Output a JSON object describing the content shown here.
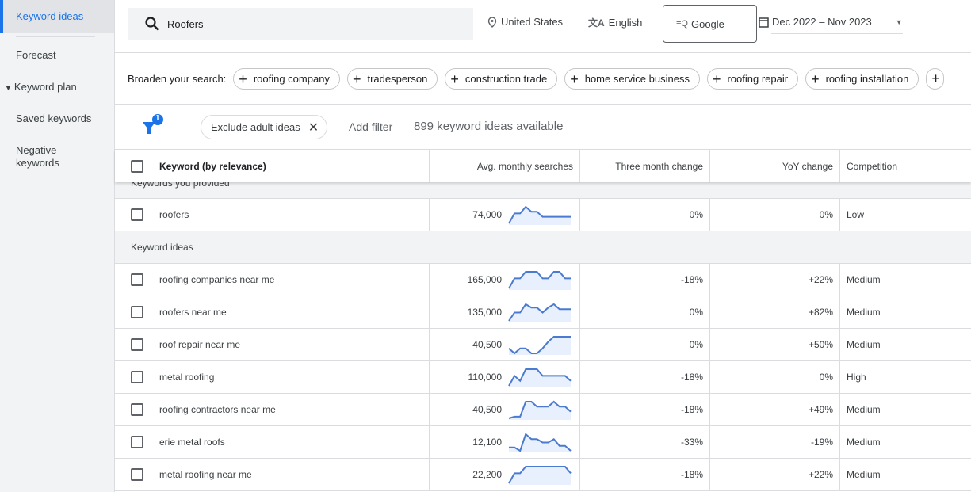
{
  "sidebar": {
    "items": [
      {
        "label": "Keyword ideas",
        "active": true
      },
      {
        "label": "Forecast"
      },
      {
        "label": "Keyword plan"
      },
      {
        "label": "Saved keywords"
      },
      {
        "label": "Negative keywords"
      }
    ]
  },
  "search": {
    "value": "Roofers",
    "icon": "search-icon"
  },
  "location": "United States",
  "language": "English",
  "network": "Google",
  "date_range": "Dec 2022 – Nov 2023",
  "broaden": {
    "label": "Broaden your search:",
    "chips": [
      "roofing company",
      "tradesperson",
      "construction trade",
      "home service business",
      "roofing repair",
      "roofing installation"
    ]
  },
  "filters": {
    "badge": "1",
    "chip": "Exclude adult ideas",
    "add_filter": "Add filter",
    "count": "899 keyword ideas available"
  },
  "accent": "#1a73e8",
  "table": {
    "columns": [
      "Keyword (by relevance)",
      "Avg. monthly searches",
      "Three month change",
      "YoY change",
      "Competition"
    ],
    "sections": [
      "Keywords you provided",
      "Keyword ideas"
    ],
    "provided": [
      {
        "keyword": "roofers",
        "searches": "74,000",
        "three_month": "0%",
        "yoy": "0%",
        "competition": "Low",
        "trend": [
          0,
          6,
          6,
          10,
          7,
          7,
          4,
          4,
          4,
          4,
          4,
          4
        ]
      }
    ],
    "ideas": [
      {
        "keyword": "roofing companies near me",
        "searches": "165,000",
        "three_month": "-18%",
        "yoy": "+22%",
        "competition": "Medium",
        "trend": [
          0,
          6,
          6,
          10,
          10,
          10,
          6,
          6,
          10,
          10,
          6,
          6
        ]
      },
      {
        "keyword": "roofers near me",
        "searches": "135,000",
        "three_month": "0%",
        "yoy": "+82%",
        "competition": "Medium",
        "trend": [
          0,
          5,
          5,
          10,
          8,
          8,
          5,
          8,
          10,
          7,
          7,
          7
        ]
      },
      {
        "keyword": "roof repair near me",
        "searches": "40,500",
        "three_month": "0%",
        "yoy": "+50%",
        "competition": "Medium",
        "trend": [
          3,
          0,
          3,
          3,
          0,
          0,
          3,
          7,
          10,
          10,
          10,
          10
        ]
      },
      {
        "keyword": "metal roofing",
        "searches": "110,000",
        "three_month": "-18%",
        "yoy": "0%",
        "competition": "High",
        "trend": [
          0,
          6,
          3,
          10,
          10,
          10,
          6,
          6,
          6,
          6,
          6,
          3
        ]
      },
      {
        "keyword": "roofing contractors near me",
        "searches": "40,500",
        "three_month": "-18%",
        "yoy": "+49%",
        "competition": "Medium",
        "trend": [
          0,
          1,
          1,
          10,
          10,
          7,
          7,
          7,
          10,
          7,
          7,
          4
        ]
      },
      {
        "keyword": "erie metal roofs",
        "searches": "12,100",
        "three_month": "-33%",
        "yoy": "-19%",
        "competition": "Medium",
        "trend": [
          2,
          2,
          0,
          10,
          7,
          7,
          5,
          5,
          7,
          3,
          3,
          0
        ]
      },
      {
        "keyword": "metal roofing near me",
        "searches": "22,200",
        "three_month": "-18%",
        "yoy": "+22%",
        "competition": "Medium",
        "trend": [
          0,
          6,
          6,
          10,
          10,
          10,
          10,
          10,
          10,
          10,
          10,
          6
        ]
      }
    ]
  }
}
